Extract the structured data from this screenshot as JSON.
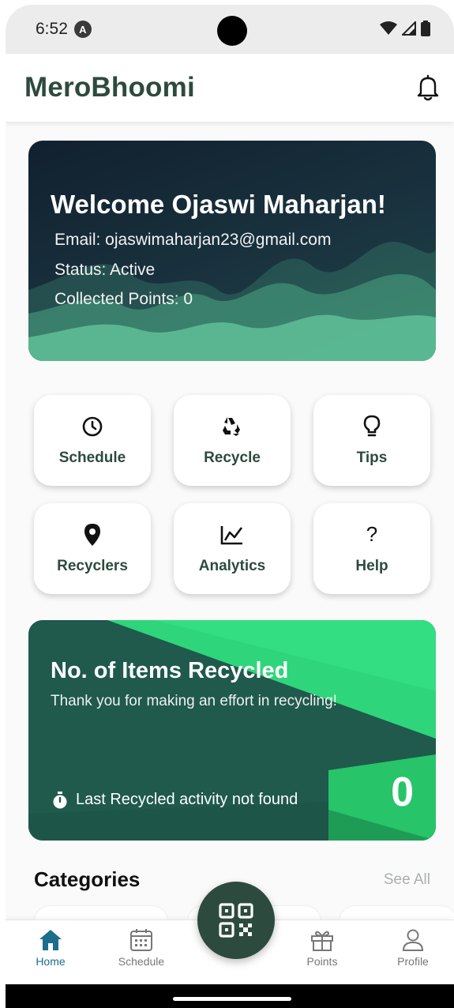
{
  "status_bar": {
    "time": "6:52",
    "badge": "A"
  },
  "header": {
    "title": "MeroBhoomi",
    "bell_icon": "bell-icon"
  },
  "welcome": {
    "title": "Welcome Ojaswi Maharjan!",
    "email": "Email: ojaswimaharjan23@gmail.com",
    "status": "Status: Active",
    "points": "Collected Points: 0"
  },
  "tiles": [
    {
      "label": "Schedule",
      "icon": "clock-icon"
    },
    {
      "label": "Recycle",
      "icon": "recycle-icon"
    },
    {
      "label": "Tips",
      "icon": "lightbulb-icon"
    },
    {
      "label": "Recyclers",
      "icon": "location-pin-icon"
    },
    {
      "label": "Analytics",
      "icon": "line-chart-icon"
    },
    {
      "label": "Help",
      "icon": "question-mark-icon",
      "glyph": "?"
    }
  ],
  "recycled": {
    "title": "No. of Items Recycled",
    "subtitle": "Thank you for making an effort in recycling!",
    "last_activity": "Last Recycled activity not found",
    "count": "0"
  },
  "categories": {
    "title": "Categories",
    "see_all": "See All"
  },
  "bottom_nav": {
    "items": [
      {
        "label": "Home",
        "icon": "home-icon",
        "active": true
      },
      {
        "label": "Schedule",
        "icon": "calendar-icon",
        "active": false
      },
      {
        "label": "Points",
        "icon": "gift-icon",
        "active": false
      },
      {
        "label": "Profile",
        "icon": "user-icon",
        "active": false
      }
    ],
    "fab_icon": "qr-code-icon"
  },
  "colors": {
    "brand": "#2d4a3e",
    "active_nav": "#1c6e8c",
    "card_dark": "#11202f",
    "accent_green": "#2fd57a"
  }
}
